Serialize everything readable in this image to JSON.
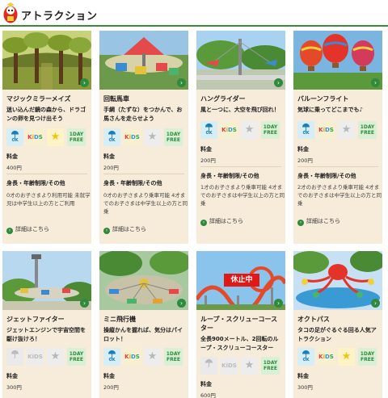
{
  "page": {
    "title": "アトラクション"
  },
  "labels": {
    "price": "料金",
    "restrictions": "身長・年齢制限/その他",
    "detail": "詳細はこちら",
    "ok": "OK",
    "free_top": "1DAY",
    "free_bottom": "FREE"
  },
  "cards": [
    {
      "name": "マジックミラーメイズ",
      "desc": "迷い込んだ鏡の森から、ドラゴンの卵を見つけ出そう",
      "price": "400円",
      "rules": "0才のお子さまより利用可能 未就学児は中学生以上の方とご利用",
      "status": ""
    },
    {
      "name": "回転馬車",
      "desc": "手綱（たずな）をつかんで、お馬さんを走らせよう",
      "price": "200円",
      "rules": "0才のお子さまより乗車可能 4才までのお子さまは中学生以上の方と同乗",
      "status": ""
    },
    {
      "name": "ハングライダー",
      "desc": "風と一つに、大空を飛び回れ！",
      "price": "200円",
      "rules": "1才のお子さまより乗車可能 4才までのお子さまは中学生以上の方と同乗",
      "status": ""
    },
    {
      "name": "バルーンフライト",
      "desc": "気球に乗ってどこまでも♪",
      "price": "200円",
      "rules": "2才のお子さまより乗車可能 4才までのお子さまは中学生以上の方と同乗",
      "status": ""
    },
    {
      "name": "ジェットファイター",
      "desc": "ジェットエンジンで宇宙空間を駆け抜けろ！",
      "price": "300円",
      "rules": "",
      "status": ""
    },
    {
      "name": "ミニ飛行機",
      "desc": "操縦かんを握れば、気分はパイロット！",
      "price": "200円",
      "rules": "",
      "status": ""
    },
    {
      "name": "ループ・スクリューコースター",
      "desc": "全長900メートル、2回転のループ・スクリューコースター",
      "price": "600円",
      "rules": "",
      "status": "休止中"
    },
    {
      "name": "オクトパス",
      "desc": "タコの足がぐるぐる回る人気アトラクション",
      "price": "300円",
      "rules": "",
      "status": ""
    }
  ]
}
